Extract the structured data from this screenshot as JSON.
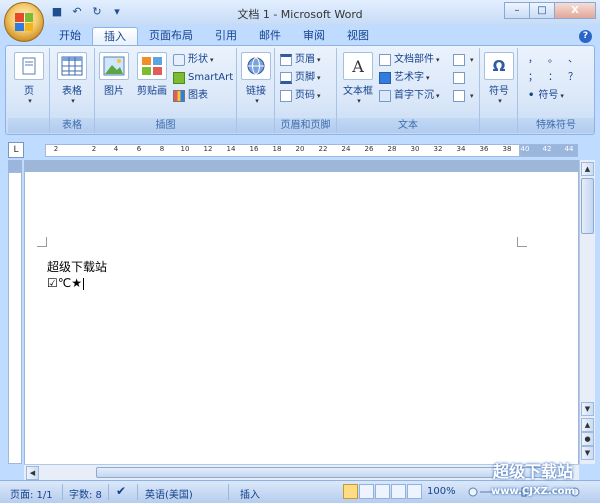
{
  "window": {
    "title": "文档 1 - Microsoft Word",
    "buttons": {
      "minimize": "–",
      "maximize": "□",
      "close": "X"
    }
  },
  "quick_access": [
    {
      "icon": "save-icon",
      "glyph": "■"
    },
    {
      "icon": "undo-icon",
      "glyph": "↶"
    },
    {
      "icon": "redo-icon",
      "glyph": "↻"
    }
  ],
  "tabs": [
    {
      "label": "开始",
      "active": false
    },
    {
      "label": "插入",
      "active": true
    },
    {
      "label": "页面布局",
      "active": false
    },
    {
      "label": "引用",
      "active": false
    },
    {
      "label": "邮件",
      "active": false
    },
    {
      "label": "审阅",
      "active": false
    },
    {
      "label": "视图",
      "active": false
    }
  ],
  "ribbon": {
    "groups": {
      "pages": {
        "label": "",
        "button": "页"
      },
      "tables": {
        "label": "表格",
        "button": "表格"
      },
      "illustrations": {
        "label": "插图",
        "picture": "图片",
        "clipart": "剪贴画",
        "shapes": "形状",
        "smartart": "SmartArt",
        "chart": "图表"
      },
      "links": {
        "label": "",
        "button": "链接"
      },
      "header_footer": {
        "label": "页眉和页脚",
        "header": "页眉",
        "footer": "页脚",
        "page_number": "页码"
      },
      "text": {
        "label": "文本",
        "textbox": "文本框",
        "quickparts": "文档部件",
        "wordart": "艺术字",
        "dropcap": "首字下沉"
      },
      "symbols": {
        "label": "",
        "button": "符号"
      },
      "special": {
        "label": "特殊符号",
        "symbol": "符号",
        "chars": [
          "，",
          "。",
          "、",
          "；",
          "：",
          "？"
        ]
      }
    }
  },
  "ruler": {
    "corner": "L",
    "ticks": [
      "2",
      "2",
      "4",
      "6",
      "8",
      "10",
      "12",
      "14",
      "16",
      "18",
      "20",
      "22",
      "24",
      "26",
      "28",
      "30",
      "32",
      "34",
      "36",
      "38",
      "40",
      "42",
      "44"
    ]
  },
  "document": {
    "line1": "超级下载站",
    "line2": "☑℃★"
  },
  "statusbar": {
    "page": "页面: 1/1",
    "words": "字数: 8",
    "language": "英语(美国)",
    "mode": "插入",
    "zoom": "100%"
  },
  "watermark": {
    "line1": "超级下载站",
    "line2": "www.CJXZ.com"
  }
}
